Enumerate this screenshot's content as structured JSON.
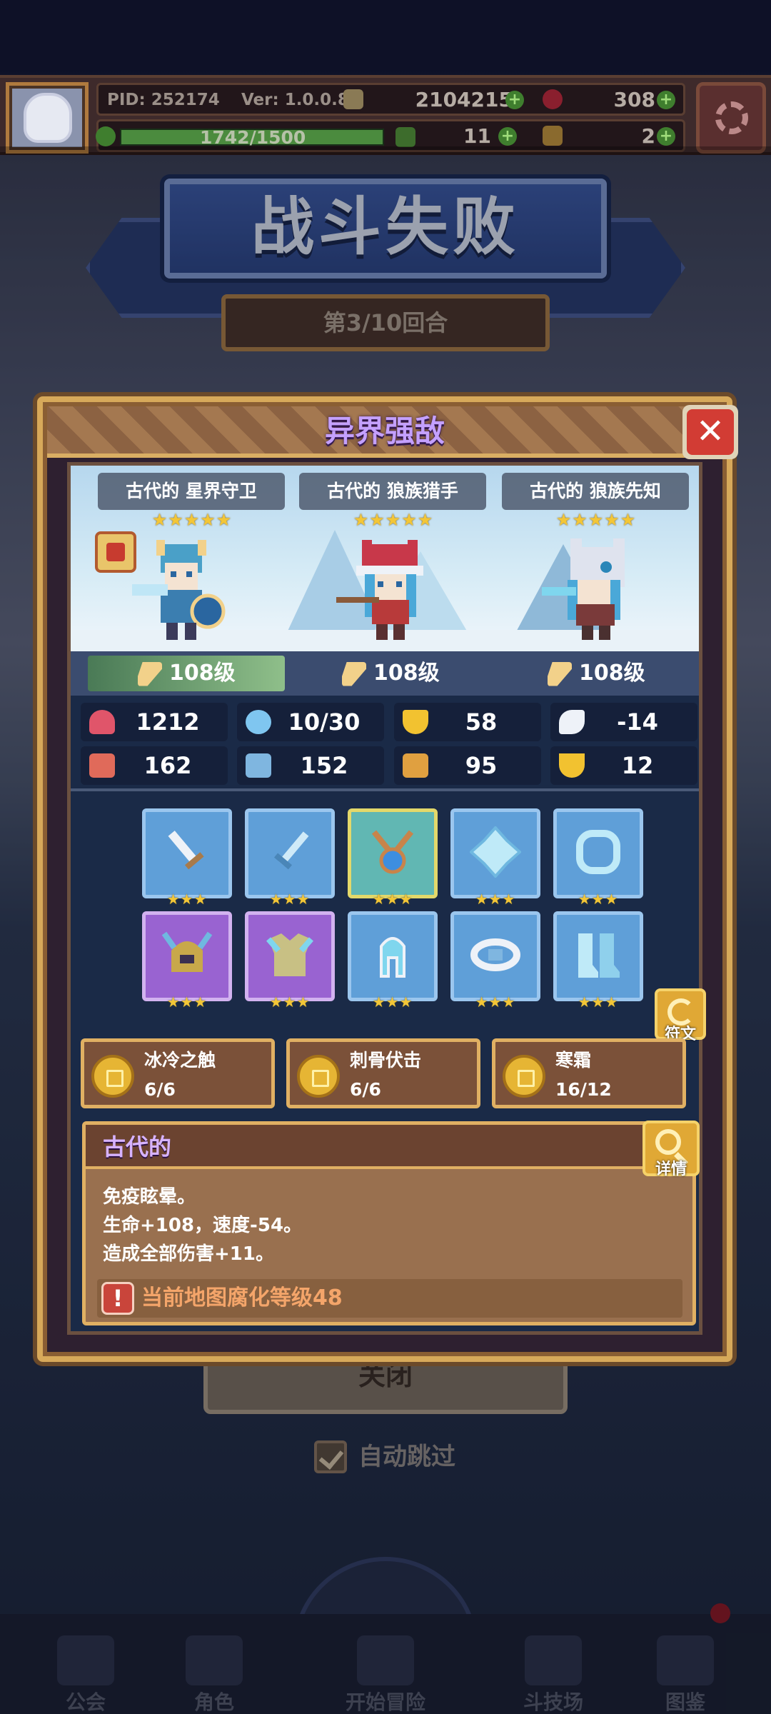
{
  "topbar": {
    "pid": "PID: 252174",
    "version": "Ver: 1.0.0.8",
    "gold": "2104215",
    "gems": "308",
    "energy": "1742/1500",
    "clover": "11",
    "keys": "2"
  },
  "banner": {
    "title": "战斗失败",
    "round": "第3/10回合"
  },
  "modal": {
    "title": "异界强敌",
    "close_glyph": "✕",
    "enemies": [
      {
        "name": "古代的 星界守卫",
        "stars": "★★★★★",
        "level": "108级"
      },
      {
        "name": "古代的 狼族猎手",
        "stars": "★★★★★",
        "level": "108级"
      },
      {
        "name": "古代的 狼族先知",
        "stars": "★★★★★",
        "level": "108级"
      }
    ],
    "stats": [
      {
        "icon": "heart-icon",
        "value": "1212",
        "color": "#e0556a"
      },
      {
        "icon": "water-drop-icon",
        "value": "10/30",
        "color": "#7fc6f0"
      },
      {
        "icon": "shield-icon",
        "value": "58",
        "color": "#f2c230"
      },
      {
        "icon": "wing-icon",
        "value": "-14",
        "color": "#eef2f8"
      },
      {
        "icon": "fist-icon",
        "value": "162",
        "color": "#e06a5a"
      },
      {
        "icon": "book-icon",
        "value": "152",
        "color": "#7fb6e0"
      },
      {
        "icon": "boot-icon",
        "value": "95",
        "color": "#e0a040"
      },
      {
        "icon": "horseshoe-icon",
        "value": "12",
        "color": "#f2c230"
      }
    ],
    "equipment_stars": "★★★",
    "rune_label": "符文",
    "skills": [
      {
        "name": "冰冷之触",
        "count": "6/6"
      },
      {
        "name": "刺骨伏击",
        "count": "6/6"
      },
      {
        "name": "寒霜",
        "count": "16/12"
      }
    ],
    "description": {
      "title": "古代的",
      "detail_label": "详情",
      "lines": [
        "免疫眩晕。",
        "生命+108，速度-54。",
        "造成全部伤害+11。"
      ],
      "warning": "当前地图腐化等级48",
      "warning_icon": "!"
    }
  },
  "background": {
    "close_button": "关闭",
    "auto_skip": "自动跳过",
    "nav": [
      "公会",
      "角色",
      "开始冒险",
      "斗技场",
      "图鉴"
    ]
  },
  "colors": {
    "accent_gold": "#d7a95a",
    "title_purple": "#c4a0ff",
    "close_red": "#d23c34",
    "star_yellow": "#f3c637"
  }
}
